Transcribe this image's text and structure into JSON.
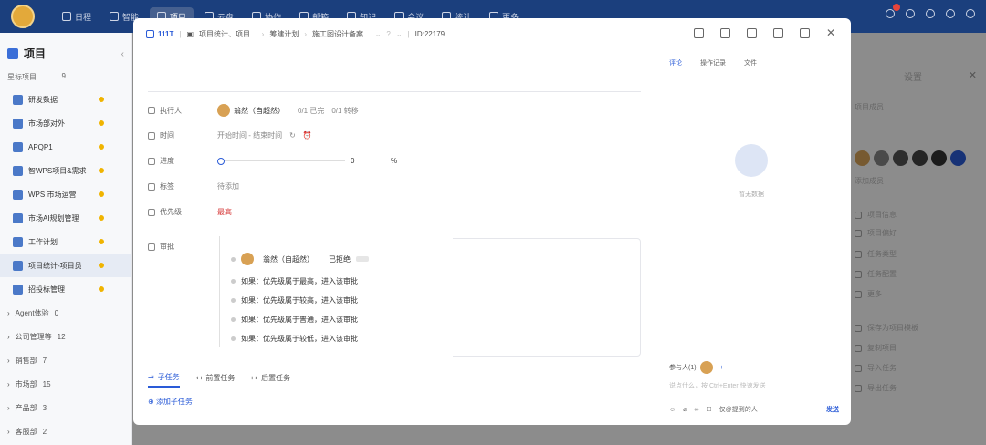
{
  "topbar": {
    "nav": [
      "日程",
      "智能",
      "项目",
      "云盘",
      "协作",
      "邮箱",
      "知识",
      "会议",
      "统计",
      "更多"
    ],
    "active_index": 2
  },
  "sidebar": {
    "title": "项目",
    "star_section": {
      "label": "星标项目",
      "count": "9"
    },
    "items": [
      "研发数据",
      "市场部对外",
      "APQP1",
      "智WPS项目&需求",
      "WPS 市场运营",
      "市场AI规划管理",
      "工作计划",
      "项目统计-项目员",
      "招投标管理"
    ],
    "selected_index": 7,
    "groups": [
      {
        "label": "Agent体验",
        "count": "0"
      },
      {
        "label": "公司管理等",
        "count": "12"
      },
      {
        "label": "销售部",
        "count": "7"
      },
      {
        "label": "市场部",
        "count": "15"
      },
      {
        "label": "产品部",
        "count": "3"
      },
      {
        "label": "客服部",
        "count": "2"
      }
    ]
  },
  "modal": {
    "id_tag": "111T",
    "breadcrumb": [
      "项目统计、项目...",
      "筹建计划",
      "施工图设计备案..."
    ],
    "task_id": "ID:22179",
    "fields": {
      "assignee_label": "执行人",
      "assignee_name": "翁然（自超然）",
      "assignee_meta1": "0/1 已完",
      "assignee_meta2": "0/1 转移",
      "time_label": "时间",
      "time_value": "开始时间 - 结束时间",
      "progress_label": "进度",
      "progress_value": "0",
      "progress_unit": "%",
      "progress_fraction": 0,
      "tag_label": "标签",
      "tag_value": "待添加",
      "priority_label": "优先级",
      "priority_value": "最高"
    },
    "approval": {
      "label": "审批",
      "approver": "翁然（自超然）",
      "status": "已拒绝",
      "rules": [
        "如果：优先级属于最高，进入该审批",
        "如果：优先级属于较高，进入该审批",
        "如果：优先级属于普通，进入该审批",
        "如果：优先级属于较低，进入该审批"
      ]
    },
    "tabs": [
      "子任务",
      "前置任务",
      "后置任务"
    ],
    "add_subtask": "添加子任务"
  },
  "side": {
    "tabs": [
      "评论",
      "操作记录",
      "文件"
    ],
    "empty": "暂无数据",
    "participants_label": "参与人(1)",
    "comment_placeholder": "说点什么，按 Ctrl+Enter 快速发送",
    "only_visible": "仅@提到的人",
    "send": "发送"
  },
  "settings": {
    "title": "设置",
    "members_label": "项目成员",
    "add_member": "添加成员",
    "menu": [
      "项目信息",
      "项目偏好",
      "任务类型",
      "任务配置",
      "更多",
      "保存为项目模板",
      "复制项目",
      "导入任务",
      "导出任务"
    ]
  }
}
